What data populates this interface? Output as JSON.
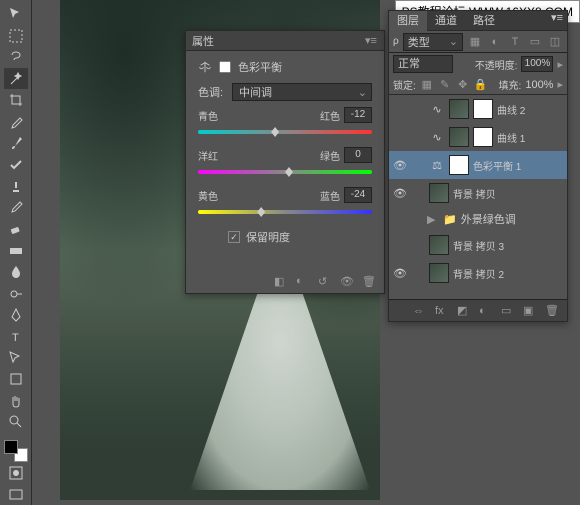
{
  "watermark": "PS教程论坛  WWW.16XX8.COM",
  "properties": {
    "panel_title": "属性",
    "adjustment_name": "色彩平衡",
    "tone_label": "色调:",
    "tone_value": "中间调",
    "sliders": [
      {
        "left": "青色",
        "right": "红色",
        "value": "-12",
        "pos": 42
      },
      {
        "left": "洋红",
        "right": "绿色",
        "value": "0",
        "pos": 50
      },
      {
        "left": "黄色",
        "right": "蓝色",
        "value": "-24",
        "pos": 34
      }
    ],
    "preserve_lum_label": "保留明度",
    "preserve_lum_checked": "✓"
  },
  "layers": {
    "tabs": [
      "图层",
      "通道",
      "路径"
    ],
    "kind_label": "类型",
    "blend_mode": "正常",
    "opacity_label": "不透明度:",
    "opacity_value": "100%",
    "lock_label": "锁定:",
    "fill_label": "填充:",
    "fill_value": "100%",
    "items": [
      {
        "type": "curves",
        "name": "曲线 2",
        "vis": false,
        "sel": false
      },
      {
        "type": "curves",
        "name": "曲线 1",
        "vis": false,
        "sel": false
      },
      {
        "type": "colbal",
        "name": "色彩平衡 1",
        "vis": true,
        "sel": true
      },
      {
        "type": "image",
        "name": "背景 拷贝",
        "vis": true,
        "sel": false
      },
      {
        "type": "group",
        "name": "外景绿色调",
        "vis": false,
        "sel": false
      },
      {
        "type": "image",
        "name": "背景 拷贝 3",
        "vis": false,
        "sel": false
      },
      {
        "type": "image",
        "name": "背景 拷贝 2",
        "vis": true,
        "sel": false
      }
    ]
  }
}
